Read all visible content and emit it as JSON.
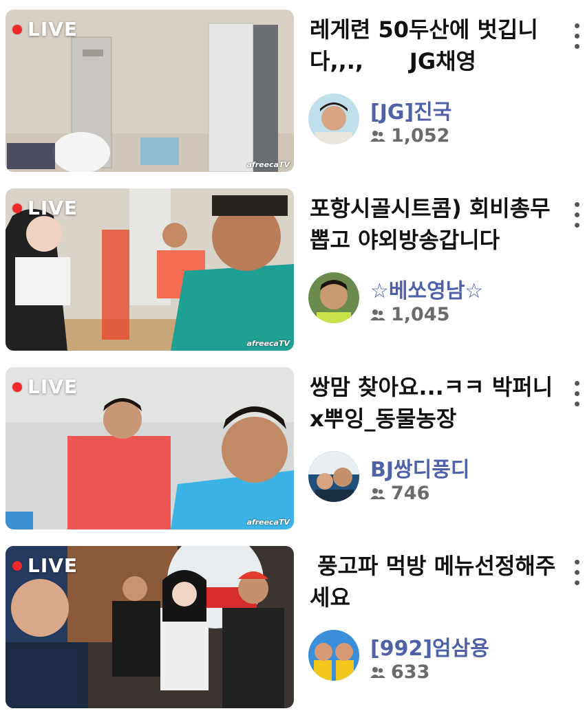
{
  "cards": [
    {
      "live_label": "LIVE",
      "watermark": "afreecaTV",
      "title": "레게련 50두산에 벗깁니다,,.,      JG채영",
      "channel": "[JG]진국",
      "viewers": "1,052"
    },
    {
      "live_label": "LIVE",
      "watermark": "afreecaTV",
      "title": "포항시골시트콤) 회비총무 뽑고 야외방송갑니다",
      "channel": "☆베쏘영남☆",
      "viewers": "1,045"
    },
    {
      "live_label": "LIVE",
      "watermark": "afreecaTV",
      "title": "쌍맘 찾아요...ㅋㅋ 박퍼니x뿌잉_동물농장",
      "channel": "BJ쌍디풍디",
      "viewers": "746"
    },
    {
      "live_label": "LIVE",
      "watermark": "",
      "title": " 풍고파 먹방 메뉴선정해주세요",
      "channel": "[992]엄삼용",
      "viewers": "633"
    }
  ],
  "icons": {
    "more": "more-vertical-icon",
    "viewers": "people-icon"
  },
  "colors": {
    "live_dot": "#ef2a2a",
    "channel": "#4f62a8",
    "viewers": "#6a6a6a"
  }
}
